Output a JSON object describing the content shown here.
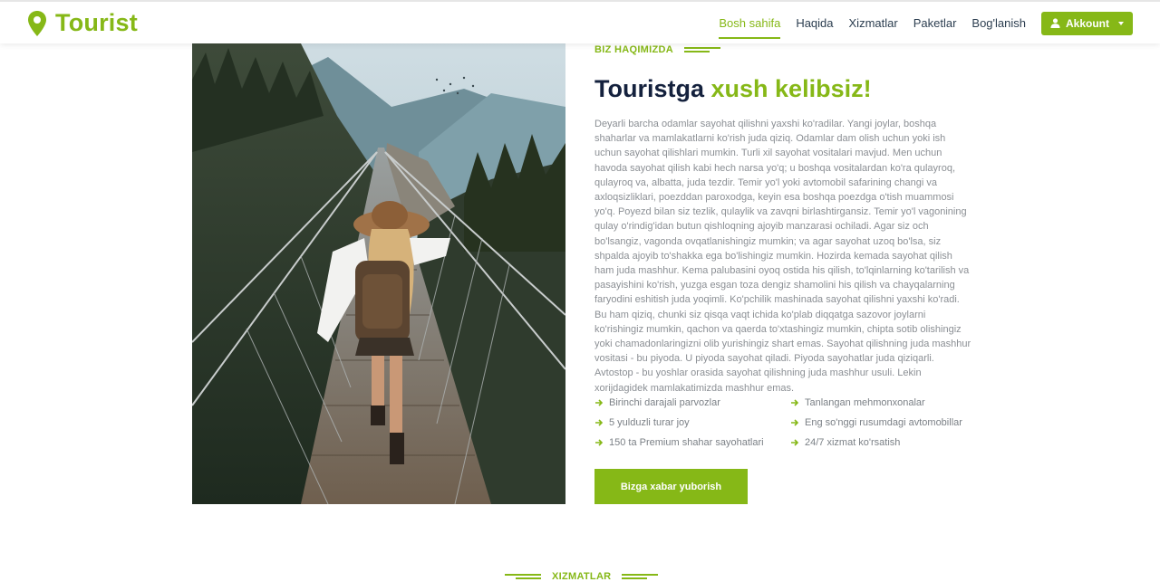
{
  "brand": {
    "name": "Tourist"
  },
  "nav": {
    "links": [
      "Bosh sahifa",
      "Haqida",
      "Xizmatlar",
      "Paketlar",
      "Bog'lanish"
    ],
    "account_label": "Akkount"
  },
  "about": {
    "kicker": "BIZ HAQIMIZDA",
    "title_part1": "Touristga ",
    "title_part2": "xush kelibsiz!",
    "paragraph": "Deyarli barcha odamlar sayohat qilishni yaxshi ko'radilar. Yangi joylar, boshqa shaharlar va mamlakatlarni ko'rish juda qiziq. Odamlar dam olish uchun yoki ish uchun sayohat qilishlari mumkin. Turli xil sayohat vositalari mavjud. Men uchun havoda sayohat qilish kabi hech narsa yo'q; u boshqa vositalardan ko'ra qulayroq, qulayroq va, albatta, juda tezdir. Temir yo'l yoki avtomobil safarining changi va axloqsizliklari, poezddan paroxodga, keyin esa boshqa poezdga o'tish muammosi yo'q. Poyezd bilan siz tezlik, qulaylik va zavqni birlashtirgansiz. Temir yo'l vagonining qulay o'rindig'idan butun qishloqning ajoyib manzarasi ochiladi. Agar siz och bo'lsangiz, vagonda ovqatlanishingiz mumkin; va agar sayohat uzoq bo'lsa, siz shpalda ajoyib to'shakka ega bo'lishingiz mumkin. Hozirda kemada sayohat qilish ham juda mashhur. Kema palubasini oyoq ostida his qilish, to'lqinlarning ko'tarilish va pasayishini ko'rish, yuzga esgan toza dengiz shamolini his qilish va chayqalarning faryodini eshitish juda yoqimli. Ko'pchilik mashinada sayohat qilishni yaxshi ko'radi. Bu ham qiziq, chunki siz qisqa vaqt ichida ko'plab diqqatga sazovor joylarni ko'rishingiz mumkin, qachon va qaerda to'xtashingiz mumkin, chipta sotib olishingiz yoki chamadonlaringizni olib yurishingiz shart emas. Sayohat qilishning juda mashhur vositasi - bu piyoda. U piyoda sayohat qiladi. Piyoda sayohatlar juda qiziqarli. Avtostop - bu yoshlar orasida sayohat qilishning juda mashhur usuli. Lekin xorijdagidek mamlakatimizda mashhur emas.",
    "features": [
      "Birinchi darajali parvozlar",
      "Tanlangan mehmonxonalar",
      "5 yulduzli turar joy",
      "Eng so'nggi rusumdagi avtomobillar",
      "150 ta Premium shahar sayohatlari",
      "24/7 xizmat ko'rsatish"
    ],
    "cta_label": "Bizga xabar yuborish"
  },
  "services": {
    "kicker": "XIZMATLAR"
  },
  "colors": {
    "accent": "#86b817",
    "dark": "#14213d",
    "text": "#8b8f94"
  },
  "icons": [
    "map-pin-icon",
    "user-icon",
    "caret-down-icon",
    "arrow-right-icon"
  ]
}
